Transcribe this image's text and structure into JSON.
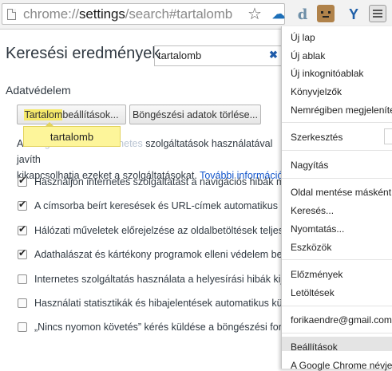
{
  "omnibox": {
    "url_prefix": "chrome://",
    "url_host": "settings",
    "url_path": "/search#tartalomb"
  },
  "icons": {
    "page": "page-icon",
    "star": "star-icon",
    "menu": "hamburger-menu-icon"
  },
  "page": {
    "title": "Keresési eredmények",
    "search_value": "tartalomb",
    "section_title": "Adatvédelem",
    "content_button_hl": "Tartalom",
    "content_button_rest": "beállítások...",
    "clear_button": "Böngészési adatok törlése...",
    "bubble": "tartalomb",
    "desc_line1_a": "A ",
    "desc_line1_faded1": "Google",
    "desc_line1_mid": " ",
    "desc_line1_faded2": "Chrome internetes",
    "desc_line1_b": " szolgáltatások használatával javíth",
    "desc_line2": "kikapcsolhatja ezeket a szolgáltatásokat. ",
    "desc_link": "További információ",
    "checkboxes": [
      {
        "label": "Használjon internetes szolgáltatást a navigációs hibák megol",
        "checked": true
      },
      {
        "label": "A címsorba beírt keresések és URL-címek automatikus kiege",
        "checked": true
      },
      {
        "label": "Hálózati műveletek előrejelzése az oldalbetöltések teljesítm",
        "checked": true
      },
      {
        "label": "Adathalászat és kártékony programok elleni védelem bekap",
        "checked": true
      },
      {
        "label": "Internetes szolgáltatás használata a helyesírási hibák kijavítá",
        "checked": false
      },
      {
        "label": "Használati statisztikák és hibajelentések automatikus küldés",
        "checked": false
      },
      {
        "label": "„Nincs nyomon követés” kérés küldése a böngészési forgalo",
        "checked": false
      }
    ]
  },
  "menu": {
    "new_tab": "Új lap",
    "new_window": "Új ablak",
    "new_incognito": "Új inkognitóablak",
    "bookmarks": "Könyvjelzők",
    "recent": "Nemrégiben megjelenített l",
    "edit": "Szerkesztés",
    "zoom": "Nagyítás",
    "save_as": "Oldal mentése másként...",
    "find": "Keresés...",
    "print": "Nyomtatás...",
    "tools": "Eszközök",
    "history": "Előzmények",
    "downloads": "Letöltések",
    "account": "forikaendre@gmail.com né",
    "settings": "Beállítások",
    "about": "A Google Chrome névjegye"
  }
}
